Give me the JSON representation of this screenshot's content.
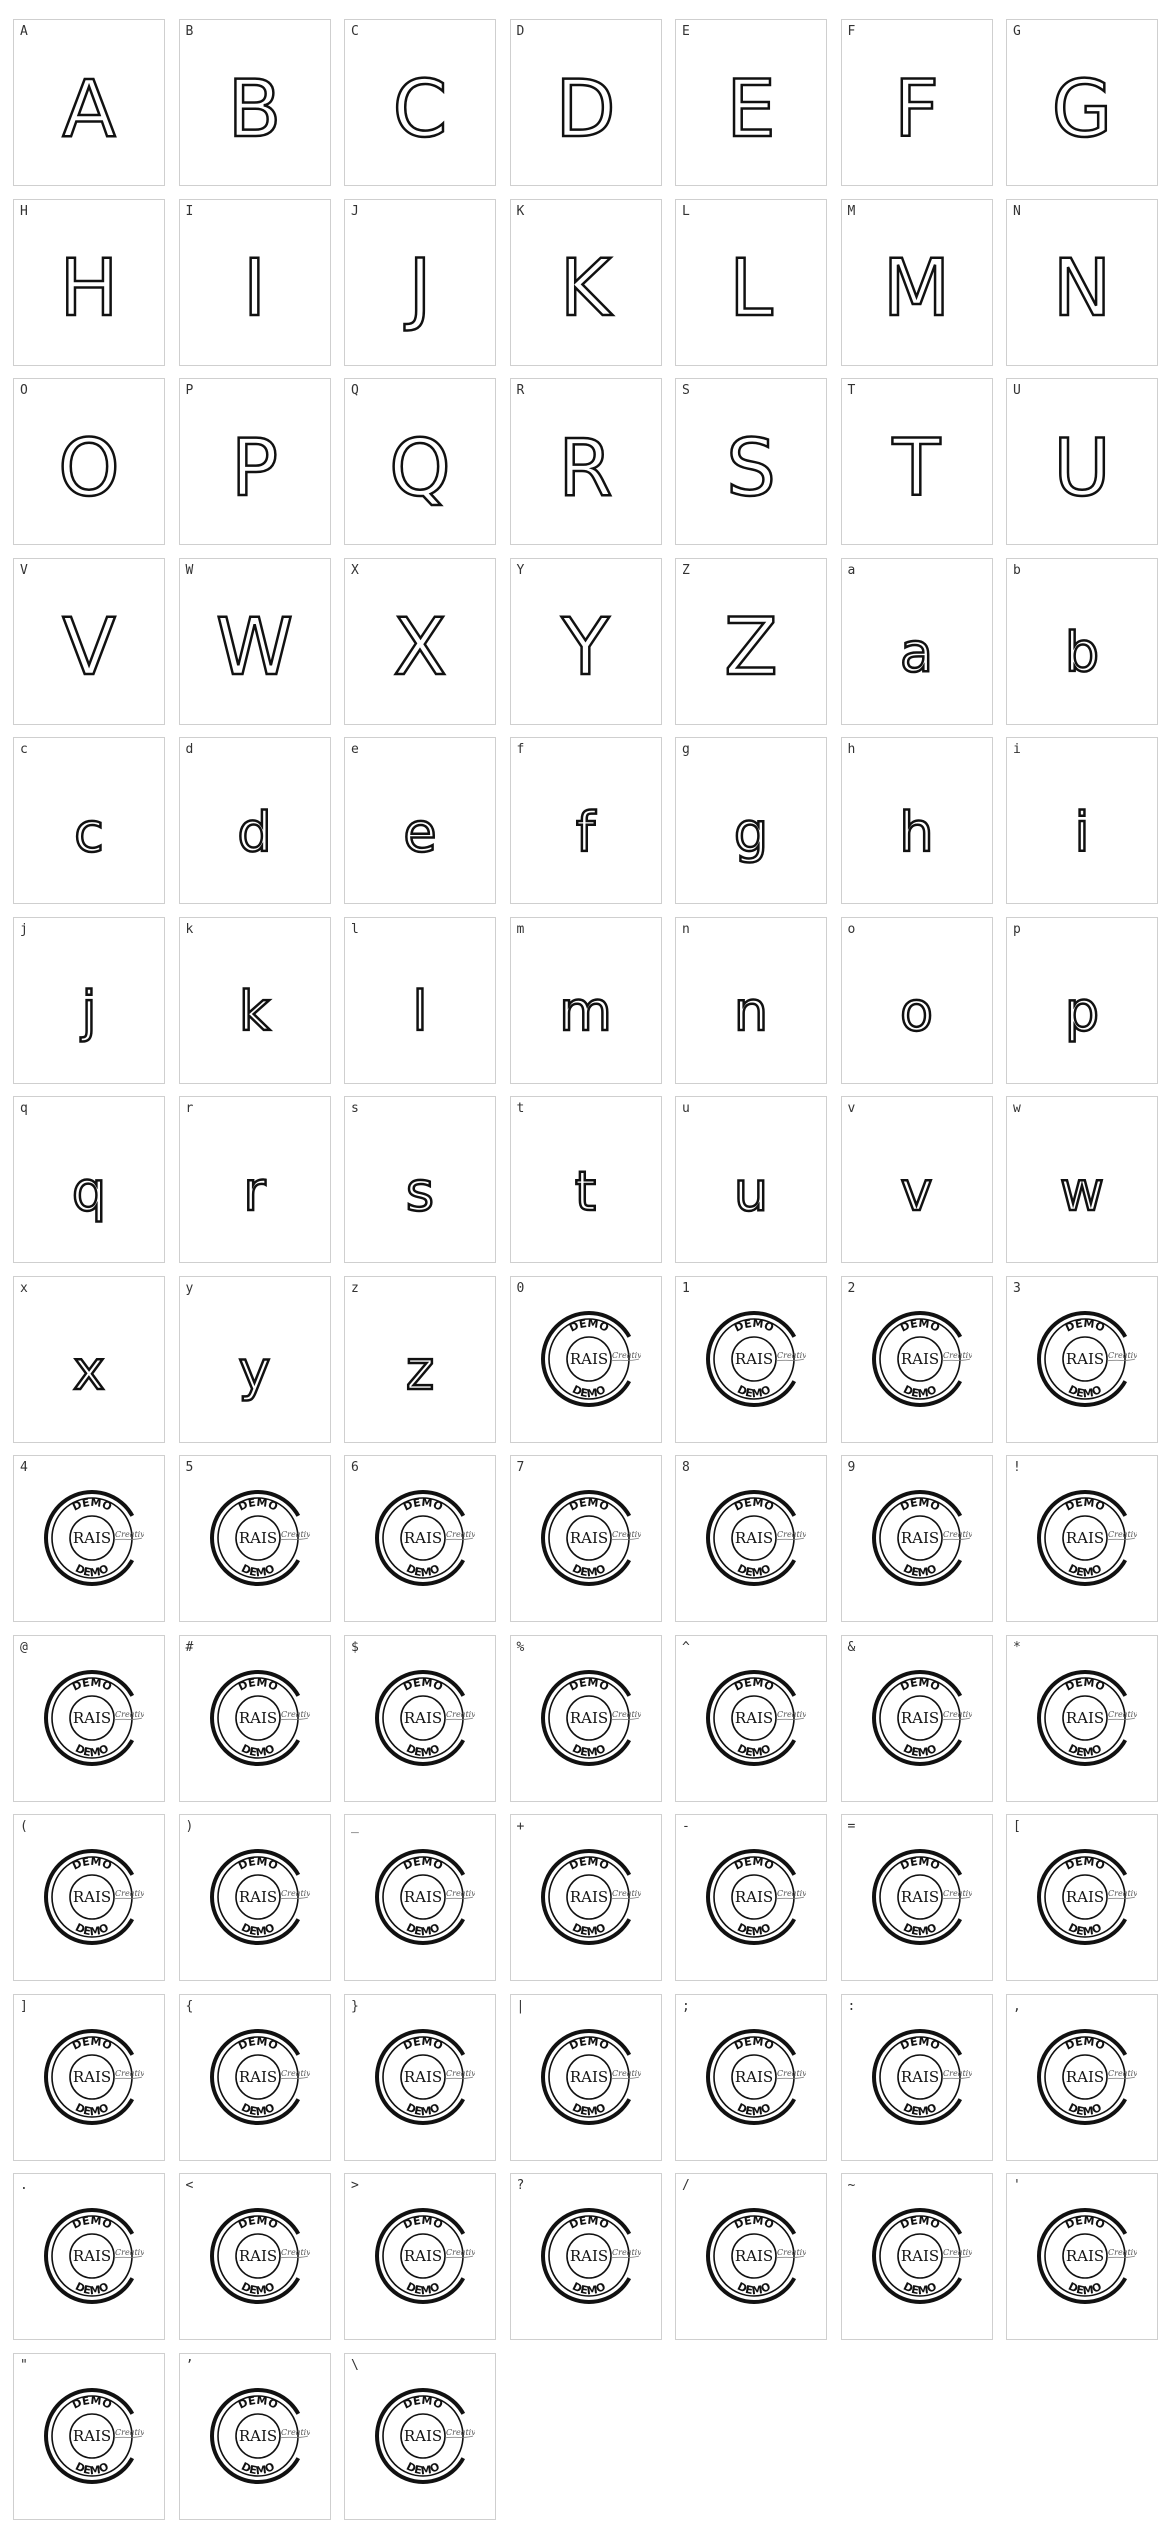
{
  "cells": [
    {
      "label": "A",
      "glyph": "A",
      "kind": "upper"
    },
    {
      "label": "B",
      "glyph": "B",
      "kind": "upper"
    },
    {
      "label": "C",
      "glyph": "C",
      "kind": "upper"
    },
    {
      "label": "D",
      "glyph": "D",
      "kind": "upper"
    },
    {
      "label": "E",
      "glyph": "E",
      "kind": "upper"
    },
    {
      "label": "F",
      "glyph": "F",
      "kind": "upper"
    },
    {
      "label": "G",
      "glyph": "G",
      "kind": "upper"
    },
    {
      "label": "H",
      "glyph": "H",
      "kind": "upper"
    },
    {
      "label": "I",
      "glyph": "I",
      "kind": "upper"
    },
    {
      "label": "J",
      "glyph": "J",
      "kind": "upper"
    },
    {
      "label": "K",
      "glyph": "K",
      "kind": "upper"
    },
    {
      "label": "L",
      "glyph": "L",
      "kind": "upper"
    },
    {
      "label": "M",
      "glyph": "M",
      "kind": "upper"
    },
    {
      "label": "N",
      "glyph": "N",
      "kind": "upper"
    },
    {
      "label": "O",
      "glyph": "O",
      "kind": "upper"
    },
    {
      "label": "P",
      "glyph": "P",
      "kind": "upper"
    },
    {
      "label": "Q",
      "glyph": "Q",
      "kind": "upper"
    },
    {
      "label": "R",
      "glyph": "R",
      "kind": "upper"
    },
    {
      "label": "S",
      "glyph": "S",
      "kind": "upper"
    },
    {
      "label": "T",
      "glyph": "T",
      "kind": "upper"
    },
    {
      "label": "U",
      "glyph": "U",
      "kind": "upper"
    },
    {
      "label": "V",
      "glyph": "V",
      "kind": "upper"
    },
    {
      "label": "W",
      "glyph": "W",
      "kind": "upper"
    },
    {
      "label": "X",
      "glyph": "X",
      "kind": "upper"
    },
    {
      "label": "Y",
      "glyph": "Y",
      "kind": "upper"
    },
    {
      "label": "Z",
      "glyph": "Z",
      "kind": "upper"
    },
    {
      "label": "a",
      "glyph": "a",
      "kind": "lower"
    },
    {
      "label": "b",
      "glyph": "b",
      "kind": "lower"
    },
    {
      "label": "c",
      "glyph": "c",
      "kind": "lower"
    },
    {
      "label": "d",
      "glyph": "d",
      "kind": "lower"
    },
    {
      "label": "e",
      "glyph": "e",
      "kind": "lower"
    },
    {
      "label": "f",
      "glyph": "f",
      "kind": "lower"
    },
    {
      "label": "g",
      "glyph": "g",
      "kind": "lower"
    },
    {
      "label": "h",
      "glyph": "h",
      "kind": "lower"
    },
    {
      "label": "i",
      "glyph": "i",
      "kind": "lower"
    },
    {
      "label": "j",
      "glyph": "j",
      "kind": "lower"
    },
    {
      "label": "k",
      "glyph": "k",
      "kind": "lower"
    },
    {
      "label": "l",
      "glyph": "l",
      "kind": "lower"
    },
    {
      "label": "m",
      "glyph": "m",
      "kind": "lower"
    },
    {
      "label": "n",
      "glyph": "n",
      "kind": "lower"
    },
    {
      "label": "o",
      "glyph": "o",
      "kind": "lower"
    },
    {
      "label": "p",
      "glyph": "p",
      "kind": "lower"
    },
    {
      "label": "q",
      "glyph": "q",
      "kind": "lower"
    },
    {
      "label": "r",
      "glyph": "r",
      "kind": "lower"
    },
    {
      "label": "s",
      "glyph": "s",
      "kind": "lower"
    },
    {
      "label": "t",
      "glyph": "t",
      "kind": "lower"
    },
    {
      "label": "u",
      "glyph": "u",
      "kind": "lower"
    },
    {
      "label": "v",
      "glyph": "v",
      "kind": "lower"
    },
    {
      "label": "w",
      "glyph": "w",
      "kind": "lower"
    },
    {
      "label": "x",
      "glyph": "x",
      "kind": "lower"
    },
    {
      "label": "y",
      "glyph": "y",
      "kind": "lower"
    },
    {
      "label": "z",
      "glyph": "z",
      "kind": "lower"
    },
    {
      "label": "0",
      "kind": "stamp"
    },
    {
      "label": "1",
      "kind": "stamp"
    },
    {
      "label": "2",
      "kind": "stamp"
    },
    {
      "label": "3",
      "kind": "stamp"
    },
    {
      "label": "4",
      "kind": "stamp"
    },
    {
      "label": "5",
      "kind": "stamp"
    },
    {
      "label": "6",
      "kind": "stamp"
    },
    {
      "label": "7",
      "kind": "stamp"
    },
    {
      "label": "8",
      "kind": "stamp"
    },
    {
      "label": "9",
      "kind": "stamp"
    },
    {
      "label": "!",
      "kind": "stamp"
    },
    {
      "label": "@",
      "kind": "stamp"
    },
    {
      "label": "#",
      "kind": "stamp"
    },
    {
      "label": "$",
      "kind": "stamp"
    },
    {
      "label": "%",
      "kind": "stamp"
    },
    {
      "label": "^",
      "kind": "stamp"
    },
    {
      "label": "&",
      "kind": "stamp"
    },
    {
      "label": "*",
      "kind": "stamp"
    },
    {
      "label": "(",
      "kind": "stamp"
    },
    {
      "label": ")",
      "kind": "stamp"
    },
    {
      "label": "_",
      "kind": "stamp"
    },
    {
      "label": "+",
      "kind": "stamp"
    },
    {
      "label": "-",
      "kind": "stamp"
    },
    {
      "label": "=",
      "kind": "stamp"
    },
    {
      "label": "[",
      "kind": "stamp"
    },
    {
      "label": "]",
      "kind": "stamp"
    },
    {
      "label": "{",
      "kind": "stamp"
    },
    {
      "label": "}",
      "kind": "stamp"
    },
    {
      "label": "|",
      "kind": "stamp"
    },
    {
      "label": ";",
      "kind": "stamp"
    },
    {
      "label": ":",
      "kind": "stamp"
    },
    {
      "label": ",",
      "kind": "stamp"
    },
    {
      "label": ".",
      "kind": "stamp"
    },
    {
      "label": "<",
      "kind": "stamp"
    },
    {
      "label": ">",
      "kind": "stamp"
    },
    {
      "label": "?",
      "kind": "stamp"
    },
    {
      "label": "/",
      "kind": "stamp"
    },
    {
      "label": "~",
      "kind": "stamp"
    },
    {
      "label": "'",
      "kind": "stamp"
    },
    {
      "label": "\"",
      "kind": "stamp"
    },
    {
      "label": "’",
      "kind": "stamp"
    },
    {
      "label": "\\",
      "kind": "stamp"
    }
  ],
  "stamp": {
    "top_text": "DEMO",
    "center_text": "RAIS",
    "bottom_text": "DEMO",
    "signature_text": "Creative"
  }
}
